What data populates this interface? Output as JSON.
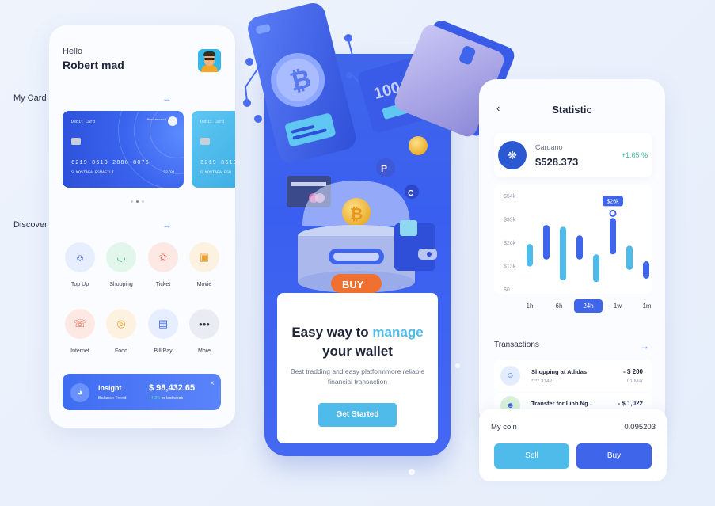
{
  "left": {
    "greeting": "Hello",
    "user_name": "Robert mad",
    "my_card_label": "My Card",
    "cards": [
      {
        "type": "Debit Card",
        "brand": "Mastercard",
        "number": "6219  8610  2888  8075",
        "holder": "S.MOSTAFA ESMAEILI",
        "expiry": "22/01"
      },
      {
        "type": "Debit Card",
        "number": "6219  8610",
        "holder": "S.MOSTAFA ESM"
      }
    ],
    "discover_label": "Discover",
    "services": [
      {
        "label": "Top Up",
        "icon": "wallet-face-icon",
        "color": "#3f66ea",
        "bg": "#e6eeff"
      },
      {
        "label": "Shopping",
        "icon": "shopping-bag-icon",
        "color": "#2fb36f",
        "bg": "#e3f6ec"
      },
      {
        "label": "Ticket",
        "icon": "ticket-star-icon",
        "color": "#e5533d",
        "bg": "#fde8e4"
      },
      {
        "label": "Movie",
        "icon": "movie-camera-icon",
        "color": "#f0a02a",
        "bg": "#fdf1df"
      },
      {
        "label": "Internet",
        "icon": "wifi-phone-icon",
        "color": "#e5533d",
        "bg": "#fde8e4"
      },
      {
        "label": "Food",
        "icon": "food-location-icon",
        "color": "#f0a02a",
        "bg": "#fdf1df"
      },
      {
        "label": "Bill Pay",
        "icon": "bill-icon",
        "color": "#3f66ea",
        "bg": "#e6eeff"
      },
      {
        "label": "More",
        "icon": "more-dots-icon",
        "color": "#2c3346",
        "bg": "#e9ecf2"
      }
    ],
    "insight": {
      "title": "Insight",
      "subtitle": "Balance Trend",
      "value": "$ 98,432.65",
      "change": "+4.3%",
      "change_suffix": "vs last week"
    }
  },
  "center": {
    "buy_label": "BUY",
    "bill_label": "100",
    "headline_pre": "Easy way to ",
    "headline_accent": "manage",
    "headline_line2": "your wallet",
    "subtext": "Best tradding and easy platformmore reliable financial transaction",
    "cta": "Get Started"
  },
  "right": {
    "title": "Statistic",
    "coin_name": "Cardano",
    "coin_price": "$528.373",
    "coin_change": "+1.65 %",
    "chart_data": {
      "type": "bar",
      "y_ticks": [
        "$54k",
        "$39k",
        "$26k",
        "$13k",
        "$0"
      ],
      "ylim": [
        0,
        54
      ],
      "highlight_label": "$26k",
      "bars": [
        {
          "low": 13,
          "high": 26,
          "color": "#4fbbea"
        },
        {
          "low": 17,
          "high": 37,
          "color": "#3f66ea"
        },
        {
          "low": 5,
          "high": 36,
          "color": "#4fbbea"
        },
        {
          "low": 17,
          "high": 31,
          "color": "#3f66ea"
        },
        {
          "low": 4,
          "high": 20,
          "color": "#4fbbea"
        },
        {
          "low": 20,
          "high": 41,
          "color": "#3f66ea"
        },
        {
          "low": 11,
          "high": 25,
          "color": "#4fbbea"
        },
        {
          "low": 6,
          "high": 16,
          "color": "#3f66ea"
        }
      ]
    },
    "periods": [
      "1h",
      "6h",
      "24h",
      "1w",
      "1m"
    ],
    "active_period": "24h",
    "transactions_label": "Transactions",
    "transactions": [
      {
        "name": "Shopping at Adidas",
        "sub": "**** 3142",
        "amount": "- $ 200",
        "date": "01 Mar"
      },
      {
        "name": "Transfer for Linh Ng...",
        "sub": "",
        "amount": "- $ 1,022",
        "date": ""
      }
    ],
    "coin_label": "My coin",
    "coin_value": "0.095203",
    "sell": "Sell",
    "buy": "Buy"
  },
  "colors": {
    "primary": "#3f66ea",
    "accent": "#4fbbea",
    "positive": "#36c2a0"
  }
}
